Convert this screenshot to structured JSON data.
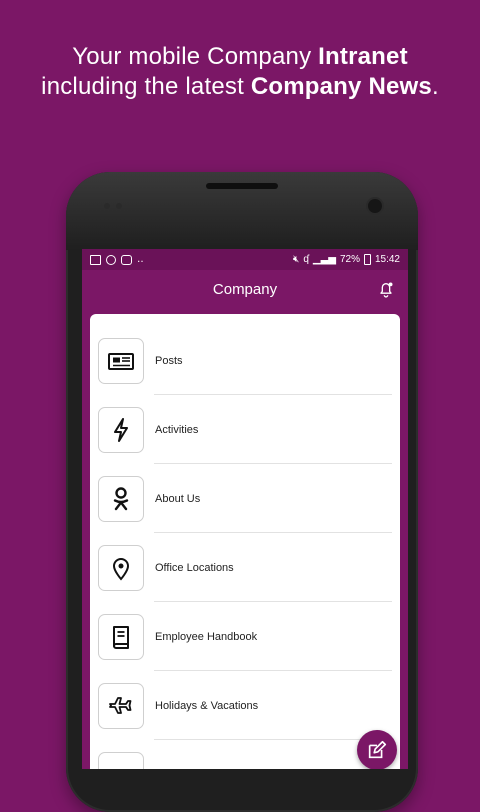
{
  "headline": {
    "line1_prefix": "Your mobile Company ",
    "line1_bold": "Intranet",
    "line2_prefix": "including the latest ",
    "line2_bold": "Company News",
    "line2_suffix": "."
  },
  "status_bar": {
    "battery": "72%",
    "time": "15:42"
  },
  "app_bar": {
    "title": "Company"
  },
  "menu": [
    {
      "label": "Posts",
      "icon": "newspaper-icon"
    },
    {
      "label": "Activities",
      "icon": "lightning-icon"
    },
    {
      "label": "About Us",
      "icon": "person-icon"
    },
    {
      "label": "Office Locations",
      "icon": "location-pin-icon"
    },
    {
      "label": "Employee Handbook",
      "icon": "book-icon"
    },
    {
      "label": "Holidays & Vacations",
      "icon": "airplane-icon"
    }
  ],
  "colors": {
    "brand": "#7b1766",
    "status_bar": "#6a1258"
  }
}
